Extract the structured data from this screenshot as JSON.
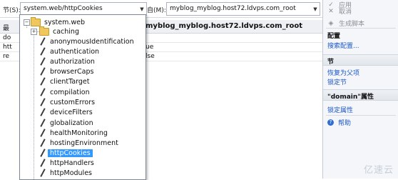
{
  "toolbar": {
    "section_label": "节(S):",
    "section_value": "system.web/httpCookies",
    "from_label": "自(M):",
    "from_value": "myblog_myblog.host72.ldvps.com_root"
  },
  "grid": {
    "header_left": "最",
    "header_right": "myblog_myblog.host72.ldvps.com_root",
    "rows": [
      {
        "key": "do",
        "value": ""
      },
      {
        "key": "htt",
        "value": "ue"
      },
      {
        "key": "re",
        "value": "lse"
      }
    ]
  },
  "tree": {
    "root": "system.web",
    "items": [
      "caching",
      "anonymousIdentification",
      "authentication",
      "authorization",
      "browserCaps",
      "clientTarget",
      "compilation",
      "customErrors",
      "deviceFilters",
      "globalization",
      "healthMonitoring",
      "hostingEnvironment",
      "httpCookies",
      "httpHandlers",
      "httpModules"
    ],
    "selected": "httpCookies"
  },
  "actions": {
    "apply": "应用",
    "cancel": "取消",
    "generate_script": "生成脚本",
    "config_head": "配置",
    "search_config": "搜索配置...",
    "section_head": "节",
    "revert_parent": "恢复为父项",
    "lock_section": "锁定节",
    "domain_attr_head": "\"domain\"属性",
    "lock_attr": "锁定属性",
    "help": "帮助"
  },
  "watermark": "亿速云",
  "colors": {
    "selection": "#3399ff",
    "link": "#1a56c8"
  }
}
